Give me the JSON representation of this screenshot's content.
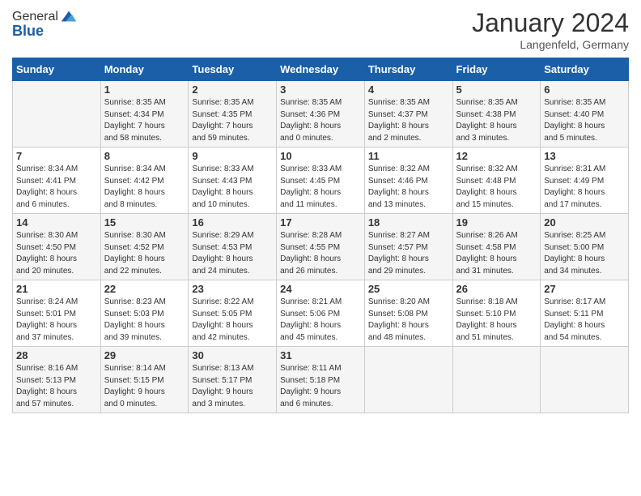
{
  "header": {
    "logo_general": "General",
    "logo_blue": "Blue",
    "month_title": "January 2024",
    "location": "Langenfeld, Germany"
  },
  "days_of_week": [
    "Sunday",
    "Monday",
    "Tuesday",
    "Wednesday",
    "Thursday",
    "Friday",
    "Saturday"
  ],
  "weeks": [
    [
      {
        "day": "",
        "info": ""
      },
      {
        "day": "1",
        "info": "Sunrise: 8:35 AM\nSunset: 4:34 PM\nDaylight: 7 hours\nand 58 minutes."
      },
      {
        "day": "2",
        "info": "Sunrise: 8:35 AM\nSunset: 4:35 PM\nDaylight: 7 hours\nand 59 minutes."
      },
      {
        "day": "3",
        "info": "Sunrise: 8:35 AM\nSunset: 4:36 PM\nDaylight: 8 hours\nand 0 minutes."
      },
      {
        "day": "4",
        "info": "Sunrise: 8:35 AM\nSunset: 4:37 PM\nDaylight: 8 hours\nand 2 minutes."
      },
      {
        "day": "5",
        "info": "Sunrise: 8:35 AM\nSunset: 4:38 PM\nDaylight: 8 hours\nand 3 minutes."
      },
      {
        "day": "6",
        "info": "Sunrise: 8:35 AM\nSunset: 4:40 PM\nDaylight: 8 hours\nand 5 minutes."
      }
    ],
    [
      {
        "day": "7",
        "info": "Sunrise: 8:34 AM\nSunset: 4:41 PM\nDaylight: 8 hours\nand 6 minutes."
      },
      {
        "day": "8",
        "info": "Sunrise: 8:34 AM\nSunset: 4:42 PM\nDaylight: 8 hours\nand 8 minutes."
      },
      {
        "day": "9",
        "info": "Sunrise: 8:33 AM\nSunset: 4:43 PM\nDaylight: 8 hours\nand 10 minutes."
      },
      {
        "day": "10",
        "info": "Sunrise: 8:33 AM\nSunset: 4:45 PM\nDaylight: 8 hours\nand 11 minutes."
      },
      {
        "day": "11",
        "info": "Sunrise: 8:32 AM\nSunset: 4:46 PM\nDaylight: 8 hours\nand 13 minutes."
      },
      {
        "day": "12",
        "info": "Sunrise: 8:32 AM\nSunset: 4:48 PM\nDaylight: 8 hours\nand 15 minutes."
      },
      {
        "day": "13",
        "info": "Sunrise: 8:31 AM\nSunset: 4:49 PM\nDaylight: 8 hours\nand 17 minutes."
      }
    ],
    [
      {
        "day": "14",
        "info": "Sunrise: 8:30 AM\nSunset: 4:50 PM\nDaylight: 8 hours\nand 20 minutes."
      },
      {
        "day": "15",
        "info": "Sunrise: 8:30 AM\nSunset: 4:52 PM\nDaylight: 8 hours\nand 22 minutes."
      },
      {
        "day": "16",
        "info": "Sunrise: 8:29 AM\nSunset: 4:53 PM\nDaylight: 8 hours\nand 24 minutes."
      },
      {
        "day": "17",
        "info": "Sunrise: 8:28 AM\nSunset: 4:55 PM\nDaylight: 8 hours\nand 26 minutes."
      },
      {
        "day": "18",
        "info": "Sunrise: 8:27 AM\nSunset: 4:57 PM\nDaylight: 8 hours\nand 29 minutes."
      },
      {
        "day": "19",
        "info": "Sunrise: 8:26 AM\nSunset: 4:58 PM\nDaylight: 8 hours\nand 31 minutes."
      },
      {
        "day": "20",
        "info": "Sunrise: 8:25 AM\nSunset: 5:00 PM\nDaylight: 8 hours\nand 34 minutes."
      }
    ],
    [
      {
        "day": "21",
        "info": "Sunrise: 8:24 AM\nSunset: 5:01 PM\nDaylight: 8 hours\nand 37 minutes."
      },
      {
        "day": "22",
        "info": "Sunrise: 8:23 AM\nSunset: 5:03 PM\nDaylight: 8 hours\nand 39 minutes."
      },
      {
        "day": "23",
        "info": "Sunrise: 8:22 AM\nSunset: 5:05 PM\nDaylight: 8 hours\nand 42 minutes."
      },
      {
        "day": "24",
        "info": "Sunrise: 8:21 AM\nSunset: 5:06 PM\nDaylight: 8 hours\nand 45 minutes."
      },
      {
        "day": "25",
        "info": "Sunrise: 8:20 AM\nSunset: 5:08 PM\nDaylight: 8 hours\nand 48 minutes."
      },
      {
        "day": "26",
        "info": "Sunrise: 8:18 AM\nSunset: 5:10 PM\nDaylight: 8 hours\nand 51 minutes."
      },
      {
        "day": "27",
        "info": "Sunrise: 8:17 AM\nSunset: 5:11 PM\nDaylight: 8 hours\nand 54 minutes."
      }
    ],
    [
      {
        "day": "28",
        "info": "Sunrise: 8:16 AM\nSunset: 5:13 PM\nDaylight: 8 hours\nand 57 minutes."
      },
      {
        "day": "29",
        "info": "Sunrise: 8:14 AM\nSunset: 5:15 PM\nDaylight: 9 hours\nand 0 minutes."
      },
      {
        "day": "30",
        "info": "Sunrise: 8:13 AM\nSunset: 5:17 PM\nDaylight: 9 hours\nand 3 minutes."
      },
      {
        "day": "31",
        "info": "Sunrise: 8:11 AM\nSunset: 5:18 PM\nDaylight: 9 hours\nand 6 minutes."
      },
      {
        "day": "",
        "info": ""
      },
      {
        "day": "",
        "info": ""
      },
      {
        "day": "",
        "info": ""
      }
    ]
  ]
}
